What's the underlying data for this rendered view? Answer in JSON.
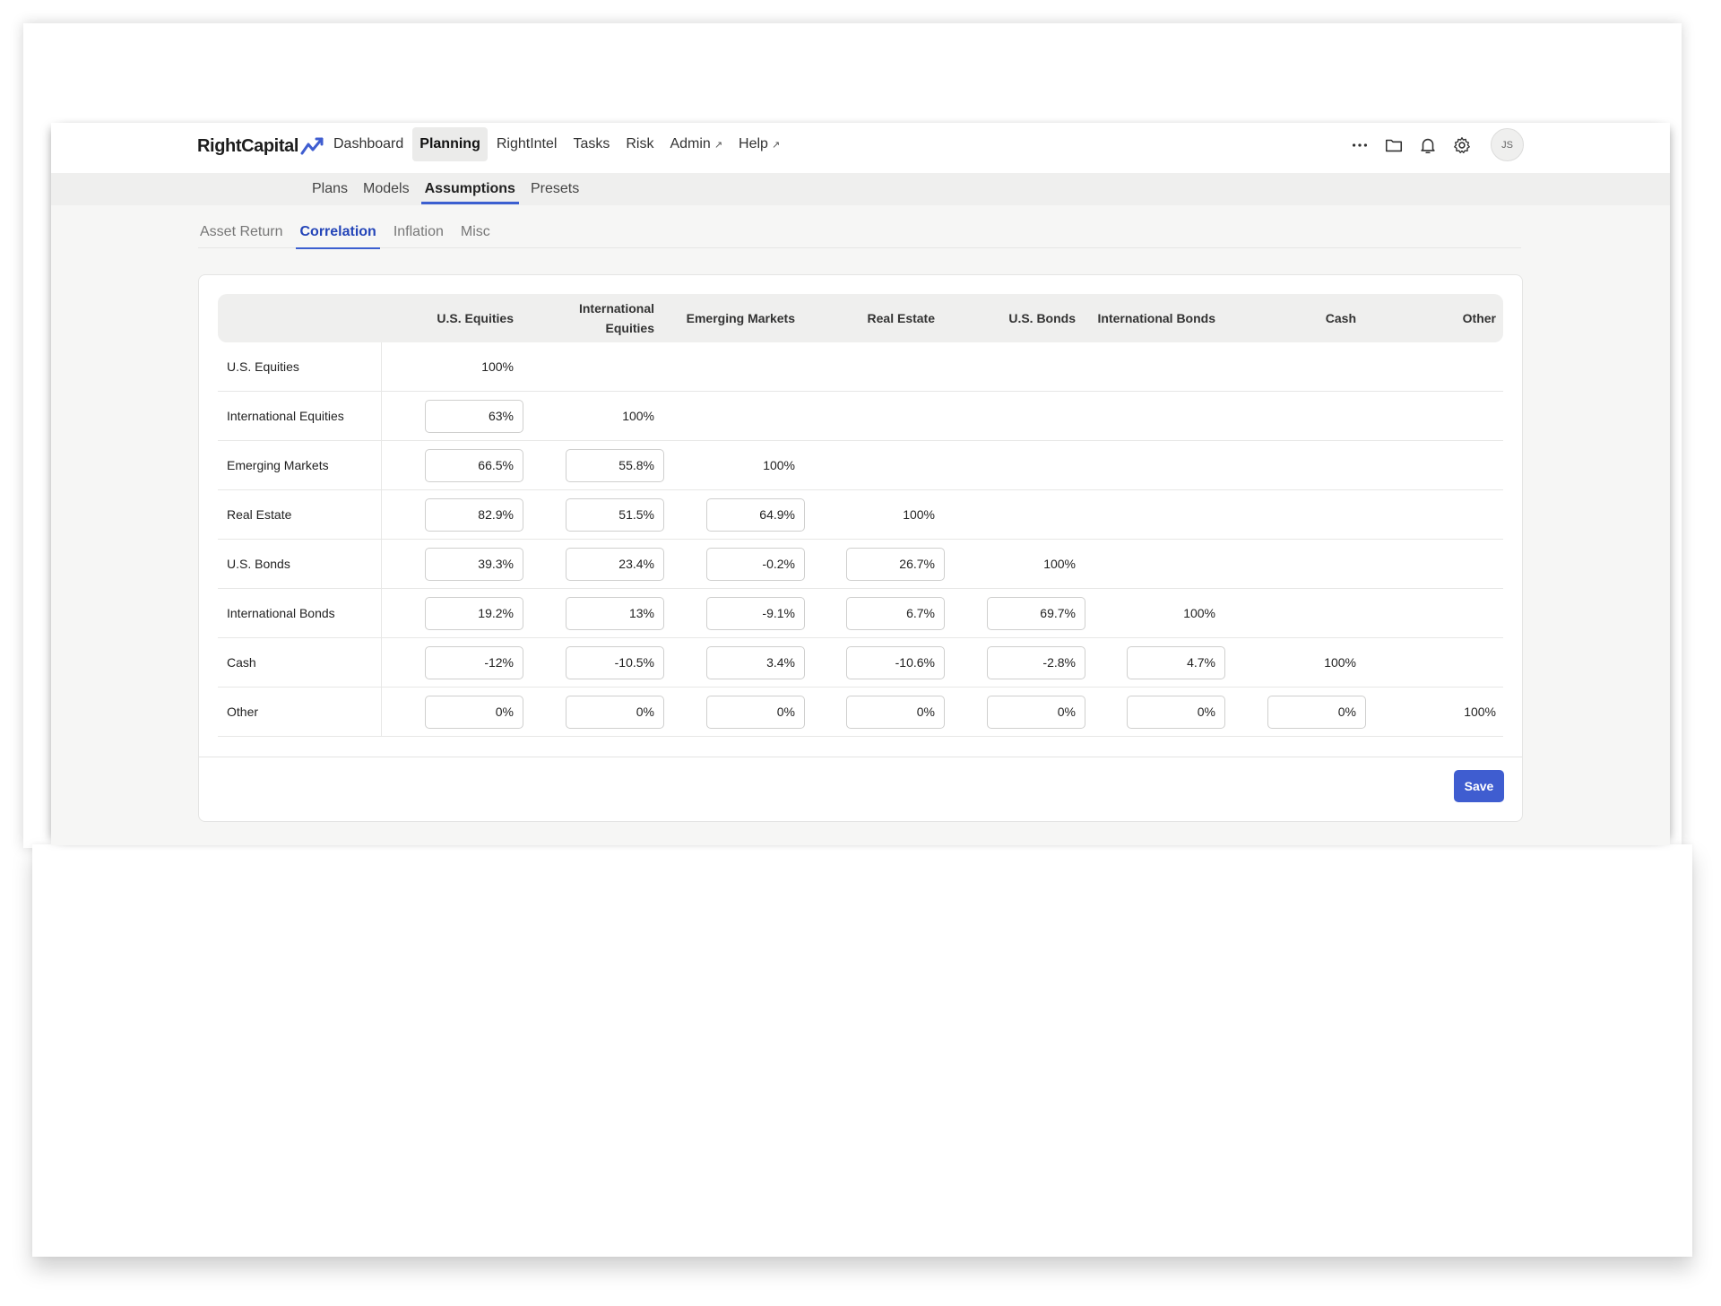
{
  "header": {
    "logo_text": "RightCapital",
    "nav": [
      {
        "label": "Dashboard",
        "active": false,
        "external": false
      },
      {
        "label": "Planning",
        "active": true,
        "external": false
      },
      {
        "label": "RightIntel",
        "active": false,
        "external": false
      },
      {
        "label": "Tasks",
        "active": false,
        "external": false
      },
      {
        "label": "Risk",
        "active": false,
        "external": false
      },
      {
        "label": "Admin",
        "active": false,
        "external": true
      },
      {
        "label": "Help",
        "active": false,
        "external": true
      }
    ],
    "external_glyph": "↗",
    "icons": [
      "more-icon",
      "folder-icon",
      "bell-icon",
      "gear-icon"
    ],
    "avatar_initials": "JS"
  },
  "subnav": [
    {
      "label": "Plans",
      "active": false
    },
    {
      "label": "Models",
      "active": false
    },
    {
      "label": "Assumptions",
      "active": true
    },
    {
      "label": "Presets",
      "active": false
    }
  ],
  "tabs": [
    {
      "label": "Asset Return",
      "active": false
    },
    {
      "label": "Correlation",
      "active": true
    },
    {
      "label": "Inflation",
      "active": false
    },
    {
      "label": "Misc",
      "active": false
    }
  ],
  "table": {
    "columns": [
      "U.S. Equities",
      "International Equities",
      "Emerging Markets",
      "Real Estate",
      "U.S. Bonds",
      "International Bonds",
      "Cash",
      "Other"
    ],
    "rows": [
      {
        "label": "U.S. Equities",
        "values": []
      },
      {
        "label": "International Equities",
        "values": [
          "63%"
        ]
      },
      {
        "label": "Emerging Markets",
        "values": [
          "66.5%",
          "55.8%"
        ]
      },
      {
        "label": "Real Estate",
        "values": [
          "82.9%",
          "51.5%",
          "64.9%"
        ]
      },
      {
        "label": "U.S. Bonds",
        "values": [
          "39.3%",
          "23.4%",
          "-0.2%",
          "26.7%"
        ]
      },
      {
        "label": "International Bonds",
        "values": [
          "19.2%",
          "13%",
          "-9.1%",
          "6.7%",
          "69.7%"
        ]
      },
      {
        "label": "Cash",
        "values": [
          "-12%",
          "-10.5%",
          "3.4%",
          "-10.6%",
          "-2.8%",
          "4.7%"
        ]
      },
      {
        "label": "Other",
        "values": [
          "0%",
          "0%",
          "0%",
          "0%",
          "0%",
          "0%",
          "0%"
        ]
      }
    ],
    "diagonal_value": "100%"
  },
  "footer": {
    "save_label": "Save"
  },
  "colors": {
    "accent": "#3f5dd0",
    "active_tab": "#2445b8"
  }
}
